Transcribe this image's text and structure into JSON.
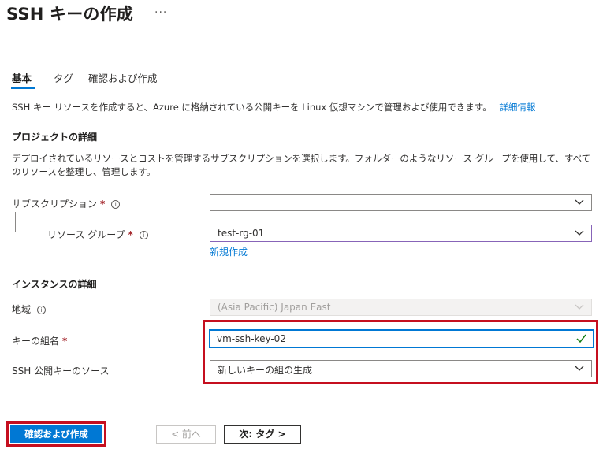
{
  "header": {
    "title": "SSH キーの作成",
    "more": "···"
  },
  "tabs": [
    {
      "label": "基本",
      "active": true
    },
    {
      "label": "タグ",
      "active": false
    },
    {
      "label": "確認および作成",
      "active": false
    }
  ],
  "intro": {
    "text": "SSH キー リソースを作成すると、Azure に格納されている公開キーを Linux 仮想マシンで管理および使用できます。",
    "link": "詳細情報"
  },
  "project": {
    "heading": "プロジェクトの詳細",
    "description": "デプロイされているリソースとコストを管理するサブスクリプションを選択します。フォルダーのようなリソース グループを使用して、すべてのリソースを整理し、管理します。",
    "subscription": {
      "label": "サブスクリプション",
      "required": "*",
      "value": ""
    },
    "resource_group": {
      "label": "リソース グループ",
      "required": "*",
      "value": "test-rg-01",
      "create_new": "新規作成"
    }
  },
  "instance": {
    "heading": "インスタンスの詳細",
    "region": {
      "label": "地域",
      "value": "(Asia Pacific) Japan East"
    },
    "key_pair_name": {
      "label": "キーの組名",
      "required": "*",
      "value": "vm-ssh-key-02"
    },
    "key_source": {
      "label": "SSH 公開キーのソース",
      "value": "新しいキーの組の生成"
    }
  },
  "footer": {
    "review_create": "確認および作成",
    "prev": "< 前へ",
    "next": "次: タグ >"
  },
  "colors": {
    "accent": "#0078d4",
    "highlight": "#c50f1f",
    "required": "#a4262c"
  }
}
